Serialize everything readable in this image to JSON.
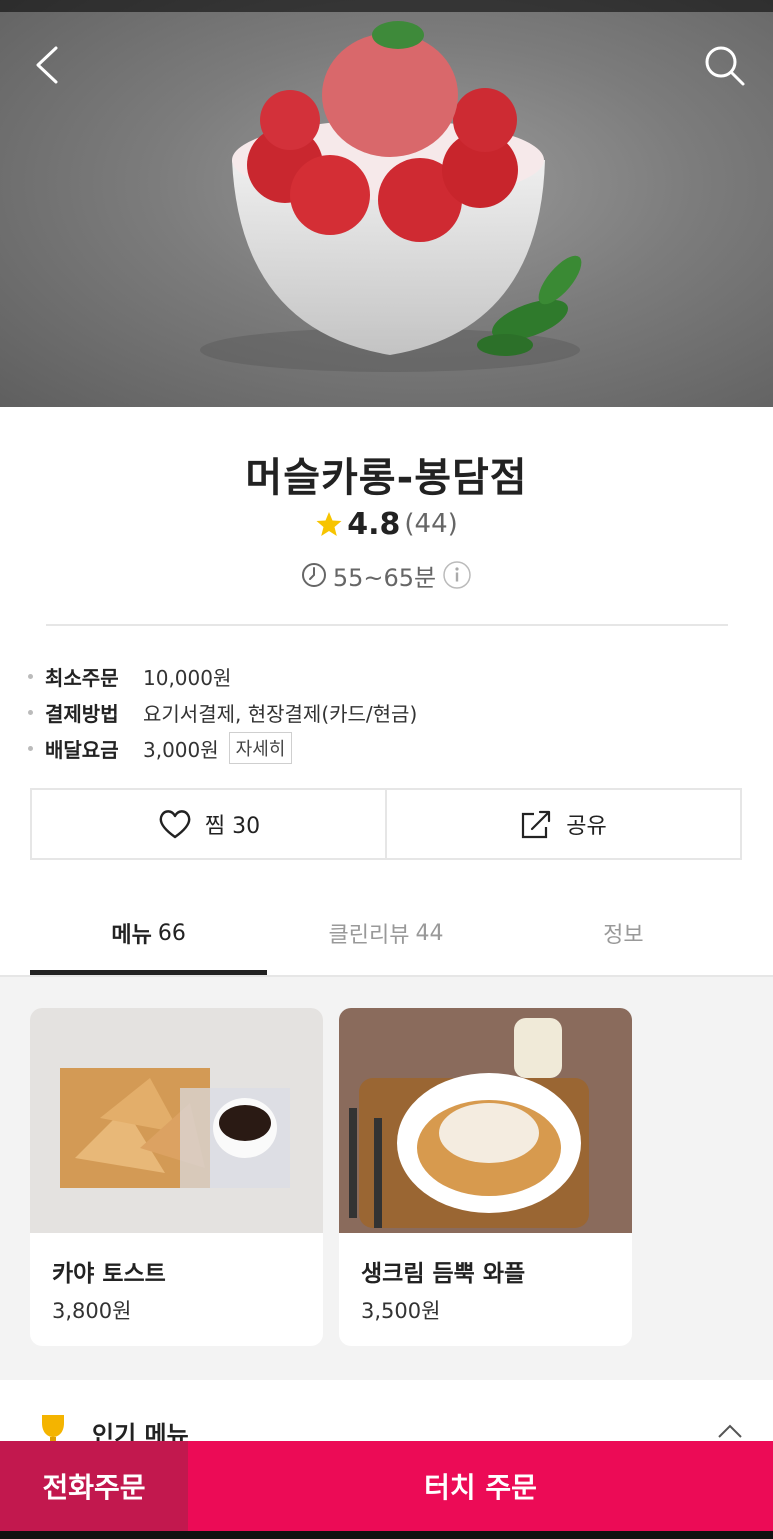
{
  "store": {
    "name": "머슬카롱-봉담점",
    "rating": "4.8",
    "review_count": "(44)",
    "delivery_time": "55~65분"
  },
  "info": {
    "min_order_label": "최소주문",
    "min_order_value": "10,000원",
    "payment_label": "결제방법",
    "payment_value": "요기서결제, 현장결제(카드/현금)",
    "fee_label": "배달요금",
    "fee_value": "3,000원",
    "fee_detail_button": "자세히"
  },
  "actions": {
    "like_label": "찜 30",
    "share_label": "공유"
  },
  "tabs": [
    {
      "label": "메뉴",
      "count": "66",
      "active": true
    },
    {
      "label": "클린리뷰",
      "count": "44",
      "active": false
    },
    {
      "label": "정보",
      "count": "",
      "active": false
    }
  ],
  "menu_items": [
    {
      "name": "카야 토스트",
      "price": "3,800원"
    },
    {
      "name": "생크림 듬뿍 와플",
      "price": "3,500원"
    }
  ],
  "popular": {
    "title": "인기 메뉴"
  },
  "bottom": {
    "call_order": "전화주문",
    "touch_order": "터치 주문"
  },
  "colors": {
    "accent": "#ec0b56",
    "call_order_bg": "#c2184e",
    "star": "#f7c400"
  },
  "icons": [
    "back-arrow-icon",
    "search-icon",
    "star-icon",
    "clock-icon",
    "info-icon",
    "heart-icon",
    "share-icon",
    "trophy-icon",
    "chevron-up-icon"
  ]
}
